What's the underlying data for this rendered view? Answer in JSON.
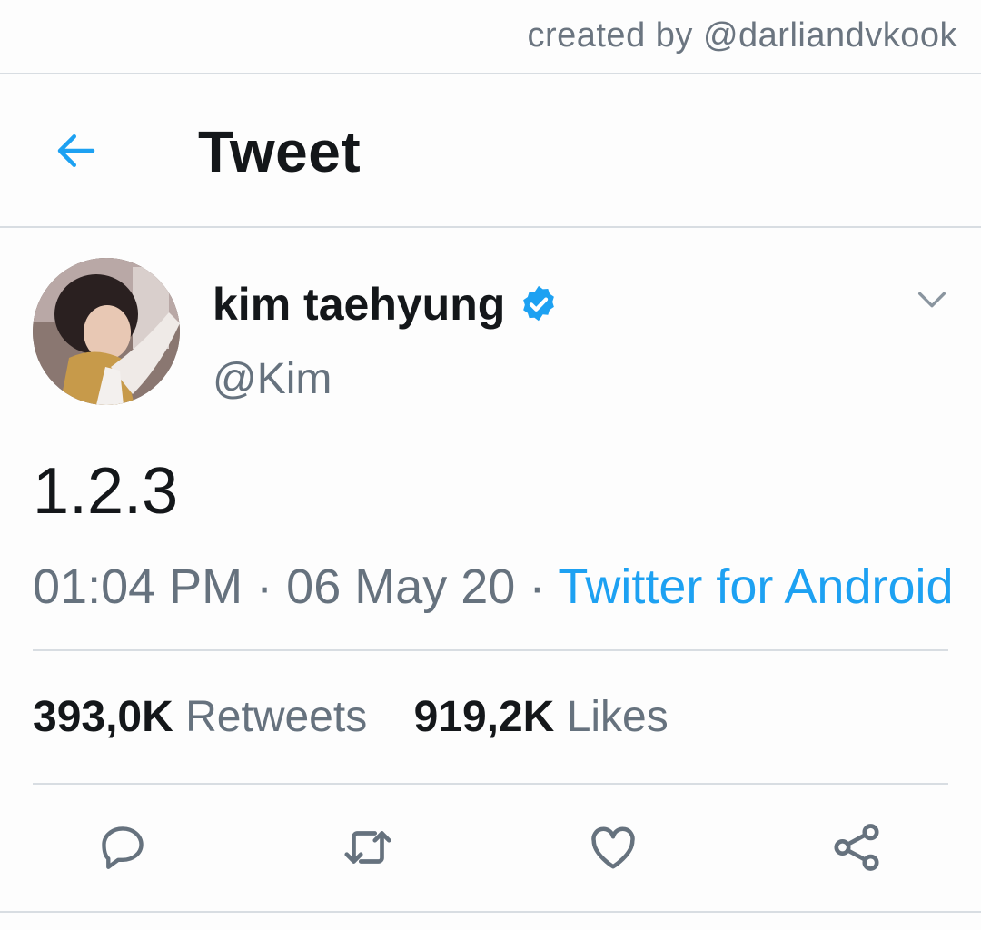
{
  "watermark": "created by @darliandvkook",
  "header": {
    "back_icon": "arrow-left-icon",
    "title": "Tweet"
  },
  "tweet": {
    "author": {
      "display_name": "kim taehyung",
      "handle": "@Kim",
      "verified": true
    },
    "text": "1.2.3",
    "time": "01:04 PM",
    "date": "06 May 20",
    "separator": "·",
    "source": "Twitter for Android",
    "retweets": "393,0K",
    "retweets_label": "Retweets",
    "likes": "919,2K",
    "likes_label": "Likes"
  },
  "actions": [
    "reply-icon",
    "retweet-icon",
    "like-icon",
    "share-icon"
  ],
  "colors": {
    "accent": "#1da1f2",
    "text": "#14171a",
    "muted": "#66727e",
    "divider": "#d8dde2"
  }
}
